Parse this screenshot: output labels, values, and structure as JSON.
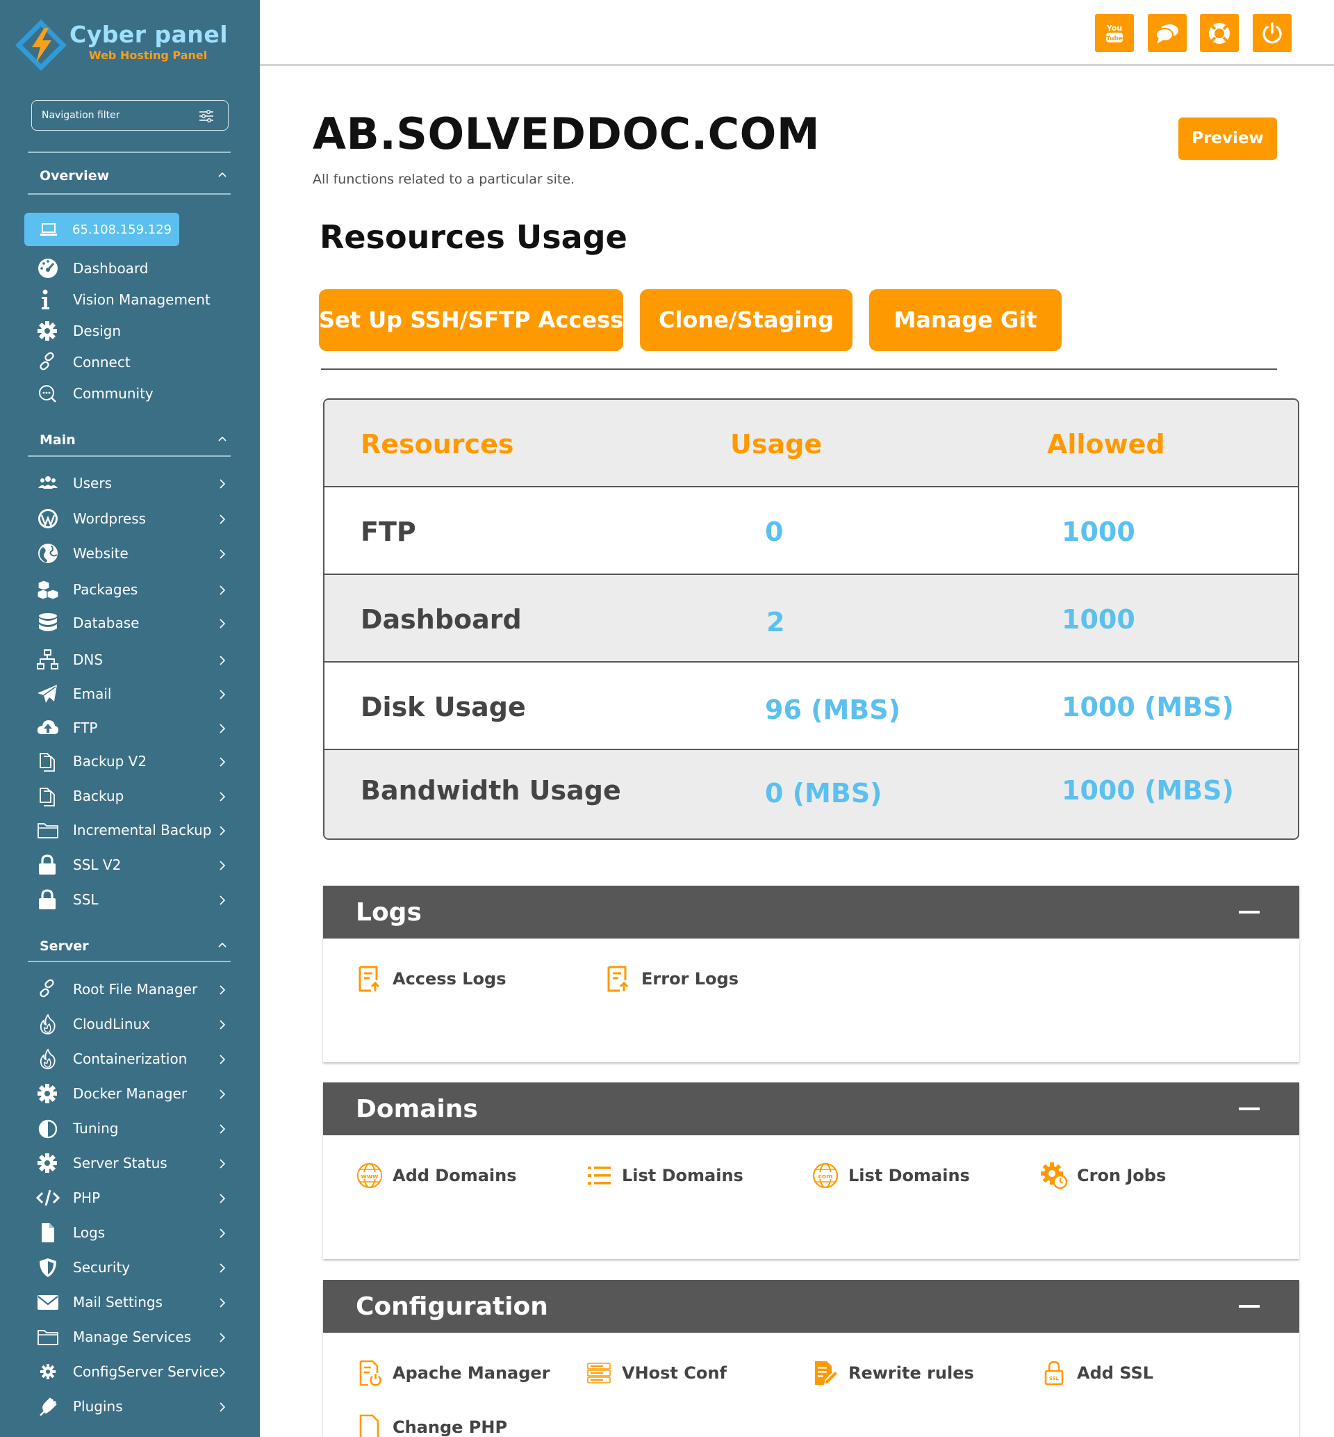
{
  "brand": {
    "name": "Cyber panel",
    "subtitle": "Web Hosting Panel"
  },
  "nav_filter": {
    "placeholder": "Navigation filter",
    "icon": "sliders-icon"
  },
  "sidebar": {
    "overview": {
      "title": "Overview",
      "ip": "65.108.159.129",
      "items": [
        {
          "label": "Dashboard",
          "icon": "speedometer-icon"
        },
        {
          "label": "Vision Management",
          "icon": "info-icon"
        },
        {
          "label": "Design",
          "icon": "gear-icon"
        },
        {
          "label": "Connect",
          "icon": "link-icon"
        },
        {
          "label": "Community",
          "icon": "chat-search-icon"
        }
      ]
    },
    "main": {
      "title": "Main",
      "items": [
        {
          "label": "Users",
          "icon": "users-icon"
        },
        {
          "label": "Wordpress",
          "icon": "wordpress-icon"
        },
        {
          "label": "Website",
          "icon": "globe-icon"
        },
        {
          "label": "Packages",
          "icon": "cubes-icon"
        },
        {
          "label": "Database",
          "icon": "database-icon"
        },
        {
          "label": "DNS",
          "icon": "sitemap-icon"
        },
        {
          "label": "Email",
          "icon": "paper-plane-icon"
        },
        {
          "label": "FTP",
          "icon": "cloud-upload-icon"
        },
        {
          "label": "Backup V2",
          "icon": "copy-icon"
        },
        {
          "label": "Backup",
          "icon": "copy-icon"
        },
        {
          "label": "Incremental Backup",
          "icon": "folder-icon"
        },
        {
          "label": "SSL V2",
          "icon": "lock-icon"
        },
        {
          "label": "SSL",
          "icon": "lock-icon"
        }
      ]
    },
    "server": {
      "title": "Server",
      "items": [
        {
          "label": "Root File Manager",
          "icon": "link-icon"
        },
        {
          "label": "CloudLinux",
          "icon": "fire-icon"
        },
        {
          "label": "Containerization",
          "icon": "fire-icon"
        },
        {
          "label": "Docker Manager",
          "icon": "gear-icon"
        },
        {
          "label": "Tuning",
          "icon": "half-circle-icon"
        },
        {
          "label": "Server Status",
          "icon": "gear-icon"
        },
        {
          "label": "PHP",
          "icon": "code-icon"
        },
        {
          "label": "Logs",
          "icon": "file-icon"
        },
        {
          "label": "Security",
          "icon": "shield-icon"
        },
        {
          "label": "Mail Settings",
          "icon": "envelope-icon"
        },
        {
          "label": "Manage Services",
          "icon": "folder-icon"
        },
        {
          "label": "ConfigServer Service",
          "icon": "cog-icon"
        },
        {
          "label": "Plugins",
          "icon": "plug-icon"
        }
      ]
    }
  },
  "topbar": {
    "buttons": [
      "youtube-icon",
      "chat-icon",
      "lifebuoy-icon",
      "power-icon"
    ]
  },
  "page": {
    "site_title": "AB.SOLVEDDOC.COM",
    "description": "All functions related to a particular site.",
    "preview_label": "Preview",
    "resources_title": "Resources Usage",
    "actions": [
      "Set Up SSH/SFTP Access",
      "Clone/Staging",
      "Manage Git"
    ]
  },
  "resources_table": {
    "headers": [
      "Resources",
      "Usage",
      "Allowed"
    ],
    "rows": [
      {
        "name": "FTP",
        "usage": "0",
        "allowed": "1000"
      },
      {
        "name": "Dashboard",
        "usage": "2",
        "allowed": "1000"
      },
      {
        "name": "Disk Usage",
        "usage": "96 (MBS)",
        "allowed": "1000 (MBS)"
      },
      {
        "name": "Bandwidth Usage",
        "usage": "0 (MBS)",
        "allowed": "1000 (MBS)"
      }
    ]
  },
  "panels": {
    "logs": {
      "title": "Logs",
      "items": [
        {
          "label": "Access Logs",
          "icon": "log-file-icon"
        },
        {
          "label": "Error Logs",
          "icon": "log-file-icon"
        }
      ]
    },
    "domains": {
      "title": "Domains",
      "items": [
        {
          "label": "Add Domains",
          "icon": "www-globe-icon"
        },
        {
          "label": "List Domains",
          "icon": "list-icon"
        },
        {
          "label": "List Domains",
          "icon": "com-globe-icon"
        },
        {
          "label": "Cron Jobs",
          "icon": "gear-clock-icon"
        }
      ]
    },
    "configuration": {
      "title": "Configuration",
      "items": [
        {
          "label": "Apache Manager",
          "icon": "file-power-icon"
        },
        {
          "label": "VHost Conf",
          "icon": "server-icon"
        },
        {
          "label": "Rewrite rules",
          "icon": "file-edit-icon"
        },
        {
          "label": "Add SSL",
          "icon": "ssl-lock-icon"
        },
        {
          "label": "Change PHP",
          "icon": "file-icon"
        }
      ]
    }
  },
  "colors": {
    "sidebar": "#3b6f86",
    "accent": "#fe9a00",
    "value": "#5bc0ef",
    "ip_pill": "#5bc0ef",
    "panel_head": "#575757"
  }
}
